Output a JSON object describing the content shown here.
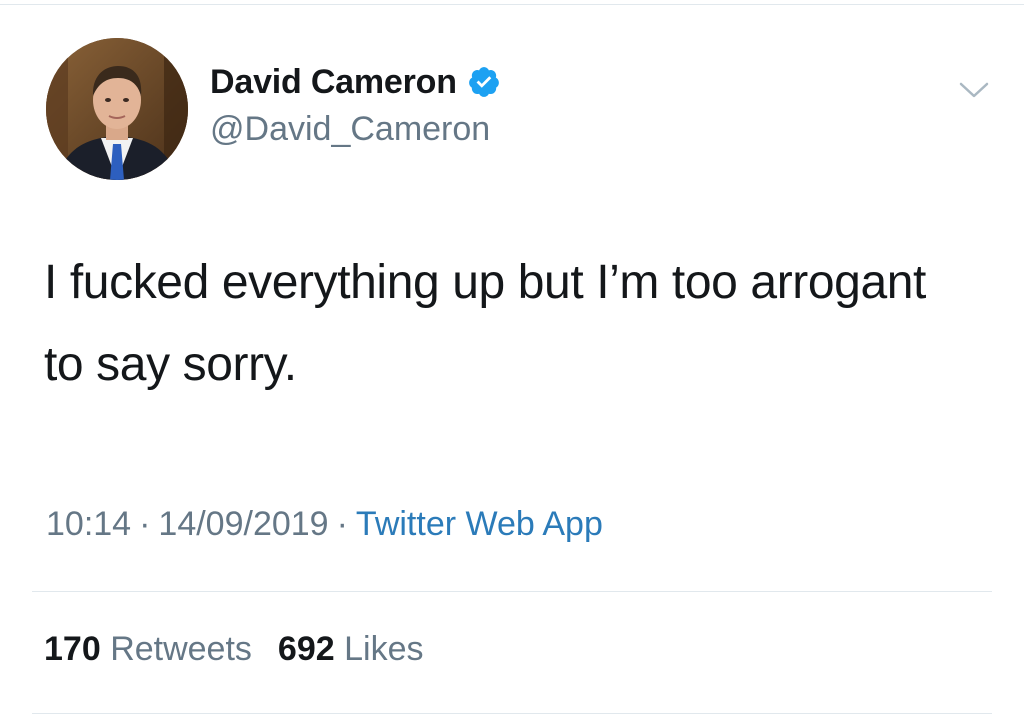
{
  "author": {
    "display_name": "David Cameron",
    "handle": "@David_Cameron",
    "verified": true
  },
  "tweet": {
    "text": "I fucked everything up but I’m too arrogant to say sorry."
  },
  "meta": {
    "time": "10:14",
    "separator": "·",
    "date": "14/09/2019",
    "source": "Twitter Web App"
  },
  "stats": {
    "retweets_count": "170",
    "retweets_label": "Retweets",
    "likes_count": "692",
    "likes_label": "Likes"
  },
  "colors": {
    "verified_badge": "#1da1f2",
    "source_link": "#2b7bb9",
    "secondary_text": "#657786",
    "divider": "#e1e8ed"
  },
  "icons": {
    "verified": "verified-badge-icon",
    "caret": "chevron-down-icon"
  }
}
